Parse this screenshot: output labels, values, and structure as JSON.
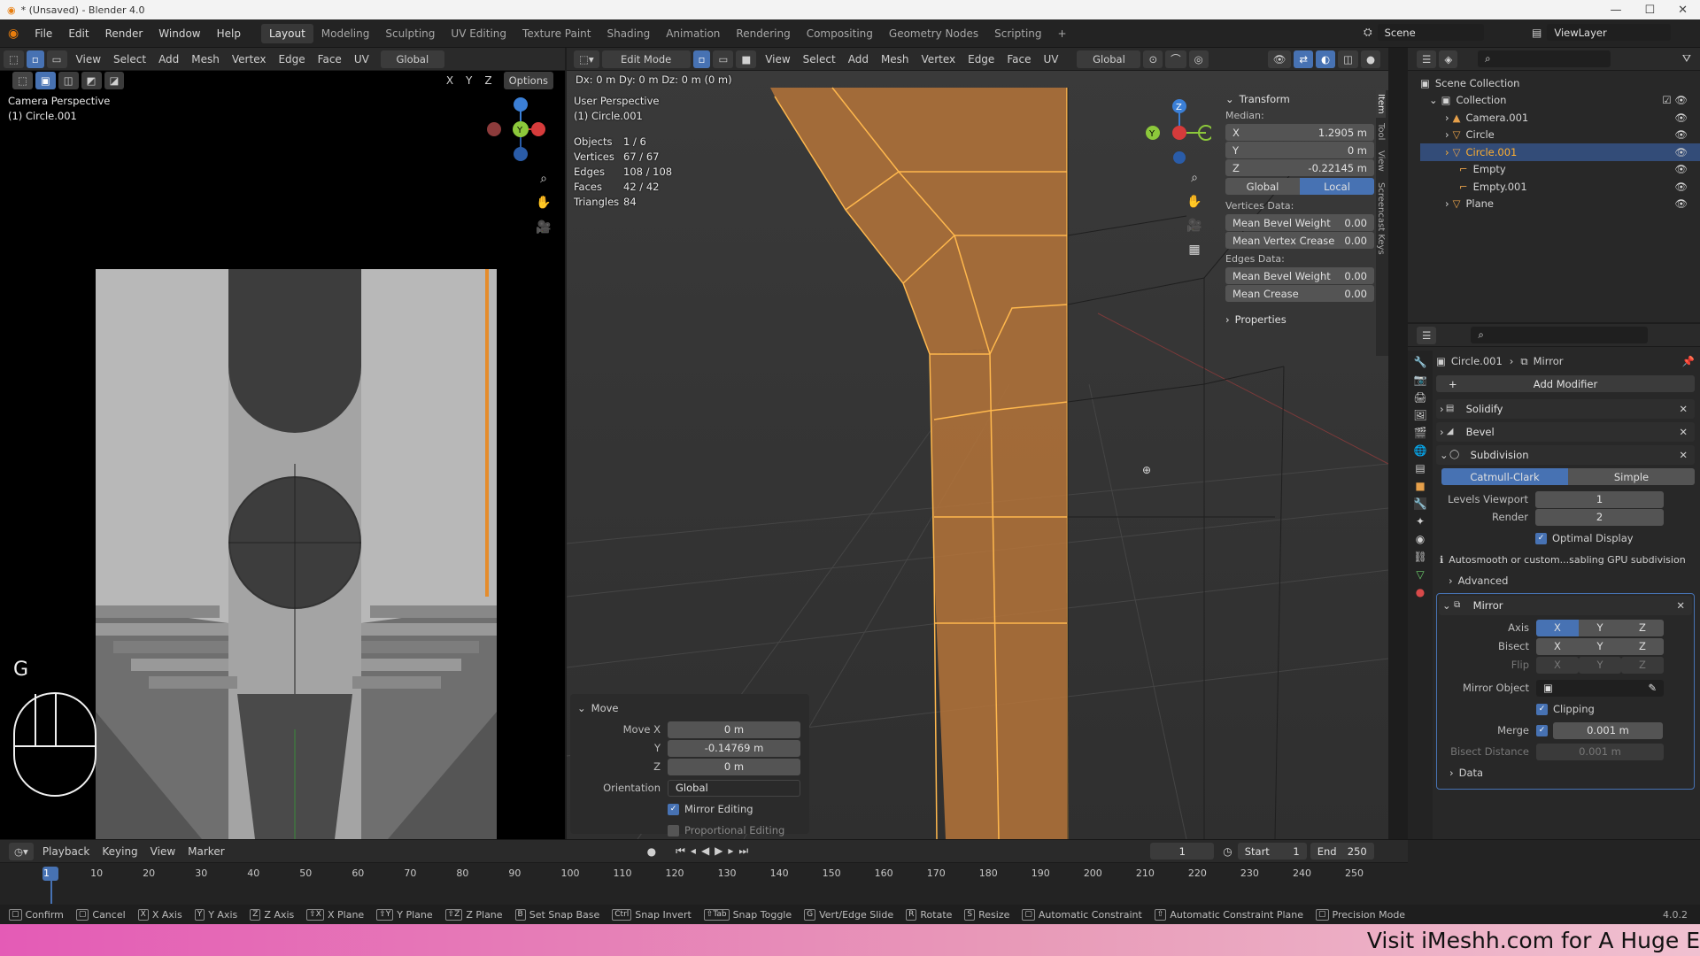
{
  "title_bar": {
    "title": "* (Unsaved) - Blender 4.0"
  },
  "top_menu": [
    "File",
    "Edit",
    "Render",
    "Window",
    "Help"
  ],
  "workspace_tabs": [
    "Layout",
    "Modeling",
    "Sculpting",
    "UV Editing",
    "Texture Paint",
    "Shading",
    "Animation",
    "Rendering",
    "Compositing",
    "Geometry Nodes",
    "Scripting"
  ],
  "workspace_add": "+",
  "scene": {
    "label": "Scene",
    "view_layer": "ViewLayer"
  },
  "left_viewport": {
    "header_menu": [
      "View",
      "Select",
      "Add",
      "Mesh",
      "Vertex",
      "Edge",
      "Face",
      "UV"
    ],
    "orientation": "Global",
    "axes_labels": [
      "X",
      "Y",
      "Z"
    ],
    "options": "Options",
    "perspective": "Camera Perspective",
    "object": "(1) Circle.001",
    "key_overlay": "G"
  },
  "main_viewport": {
    "mode": "Edit Mode",
    "header_menu": [
      "View",
      "Select",
      "Add",
      "Mesh",
      "Vertex",
      "Edge",
      "Face",
      "UV"
    ],
    "orientation": "Global",
    "delta": "Dx: 0 m   Dy: 0 m   Dz: 0 m (0 m)",
    "perspective": "User Perspective",
    "object": "(1) Circle.001",
    "stats": [
      {
        "label": "Objects",
        "value": "1 / 6"
      },
      {
        "label": "Vertices",
        "value": "67 / 67"
      },
      {
        "label": "Edges",
        "value": "108 / 108"
      },
      {
        "label": "Faces",
        "value": "42 / 42"
      },
      {
        "label": "Triangles",
        "value": "84"
      }
    ],
    "gizmo": {
      "z": "Z",
      "y": "Y"
    },
    "side_tabs": [
      "Item",
      "Tool",
      "View",
      "Screencast Keys"
    ]
  },
  "transform_panel": {
    "title": "Transform",
    "median": "Median:",
    "x_label": "X",
    "x": "1.2905 m",
    "y_label": "Y",
    "y": "0 m",
    "z_label": "Z",
    "z": "-0.22145 m",
    "global": "Global",
    "local": "Local",
    "vertices_data": "Vertices Data:",
    "mean_bevel_weight_label": "Mean Bevel Weight",
    "mean_bevel_weight": "0.00",
    "mean_vertex_crease_label": "Mean Vertex Crease",
    "mean_vertex_crease": "0.00",
    "edges_data": "Edges Data:",
    "edge_bevel_weight_label": "Mean Bevel Weight",
    "edge_bevel_weight": "0.00",
    "mean_crease_label": "Mean Crease",
    "mean_crease": "0.00",
    "properties": "Properties"
  },
  "move_panel": {
    "title": "Move",
    "move_x_label": "Move X",
    "move_x": "0 m",
    "y_label": "Y",
    "y": "-0.14769 m",
    "z_label": "Z",
    "z": "0 m",
    "orientation_label": "Orientation",
    "orientation": "Global",
    "mirror_editing": "Mirror Editing",
    "proportional_editing": "Proportional Editing"
  },
  "outliner": {
    "scene_collection": "Scene Collection",
    "collection": "Collection",
    "items": [
      "Camera.001",
      "Circle",
      "Circle.001",
      "Empty",
      "Empty.001",
      "Plane"
    ]
  },
  "properties_editor": {
    "breadcrumb_object": "Circle.001",
    "breadcrumb_modifier": "Mirror",
    "add_modifier": "Add Modifier",
    "modifiers": [
      "Solidify",
      "Bevel",
      "Subdivision"
    ],
    "subdivision": {
      "catmull": "Catmull-Clark",
      "simple": "Simple",
      "levels_viewport_label": "Levels Viewport",
      "levels_viewport": "1",
      "render_label": "Render",
      "render": "2",
      "optimal_display": "Optimal Display",
      "warning": "Autosmooth or custom...sabling GPU subdivision",
      "advanced": "Advanced"
    },
    "mirror": {
      "name": "Mirror",
      "axis_label": "Axis",
      "bisect_label": "Bisect",
      "flip_label": "Flip",
      "axes": [
        "X",
        "Y",
        "Z"
      ],
      "mirror_object_label": "Mirror Object",
      "clipping": "Clipping",
      "merge_label": "Merge",
      "merge": "0.001 m",
      "bisect_distance_label": "Bisect Distance",
      "bisect_distance": "0.001 m",
      "data": "Data"
    }
  },
  "timeline": {
    "menus": [
      "Playback",
      "Keying",
      "View",
      "Marker"
    ],
    "current_frame": "1",
    "start_label": "Start",
    "start": "1",
    "end_label": "End",
    "end": "250",
    "ticks": [
      "1",
      "10",
      "20",
      "30",
      "40",
      "50",
      "60",
      "70",
      "80",
      "90",
      "100",
      "110",
      "120",
      "130",
      "140",
      "150",
      "160",
      "170",
      "180",
      "190",
      "200",
      "210",
      "220",
      "230",
      "240",
      "250"
    ]
  },
  "status_bar": {
    "items": [
      {
        "key": "",
        "label": "Confirm"
      },
      {
        "key": "",
        "label": "Cancel"
      },
      {
        "key": "X",
        "label": "X Axis"
      },
      {
        "key": "Y",
        "label": "Y Axis"
      },
      {
        "key": "Z",
        "label": "Z Axis"
      },
      {
        "key": "⇧X",
        "label": "X Plane"
      },
      {
        "key": "⇧Y",
        "label": "Y Plane"
      },
      {
        "key": "⇧Z",
        "label": "Z Plane"
      },
      {
        "key": "B",
        "label": "Set Snap Base"
      },
      {
        "key": "Ctrl",
        "label": "Snap Invert"
      },
      {
        "key": "⇧Tab",
        "label": "Snap Toggle"
      },
      {
        "key": "G",
        "label": "Vert/Edge Slide"
      },
      {
        "key": "R",
        "label": "Rotate"
      },
      {
        "key": "S",
        "label": "Resize"
      },
      {
        "key": "",
        "label": "Automatic Constraint"
      },
      {
        "key": "⇧",
        "label": "Automatic Constraint Plane"
      },
      {
        "key": "",
        "label": "Precision Mode"
      }
    ],
    "version": "4.0.2"
  },
  "banner": {
    "text": "Visit iMeshh.com for A Huge E"
  },
  "colors": {
    "accent": "#4772b3",
    "selection": "#f5a742",
    "banner": "#e45bb6"
  }
}
